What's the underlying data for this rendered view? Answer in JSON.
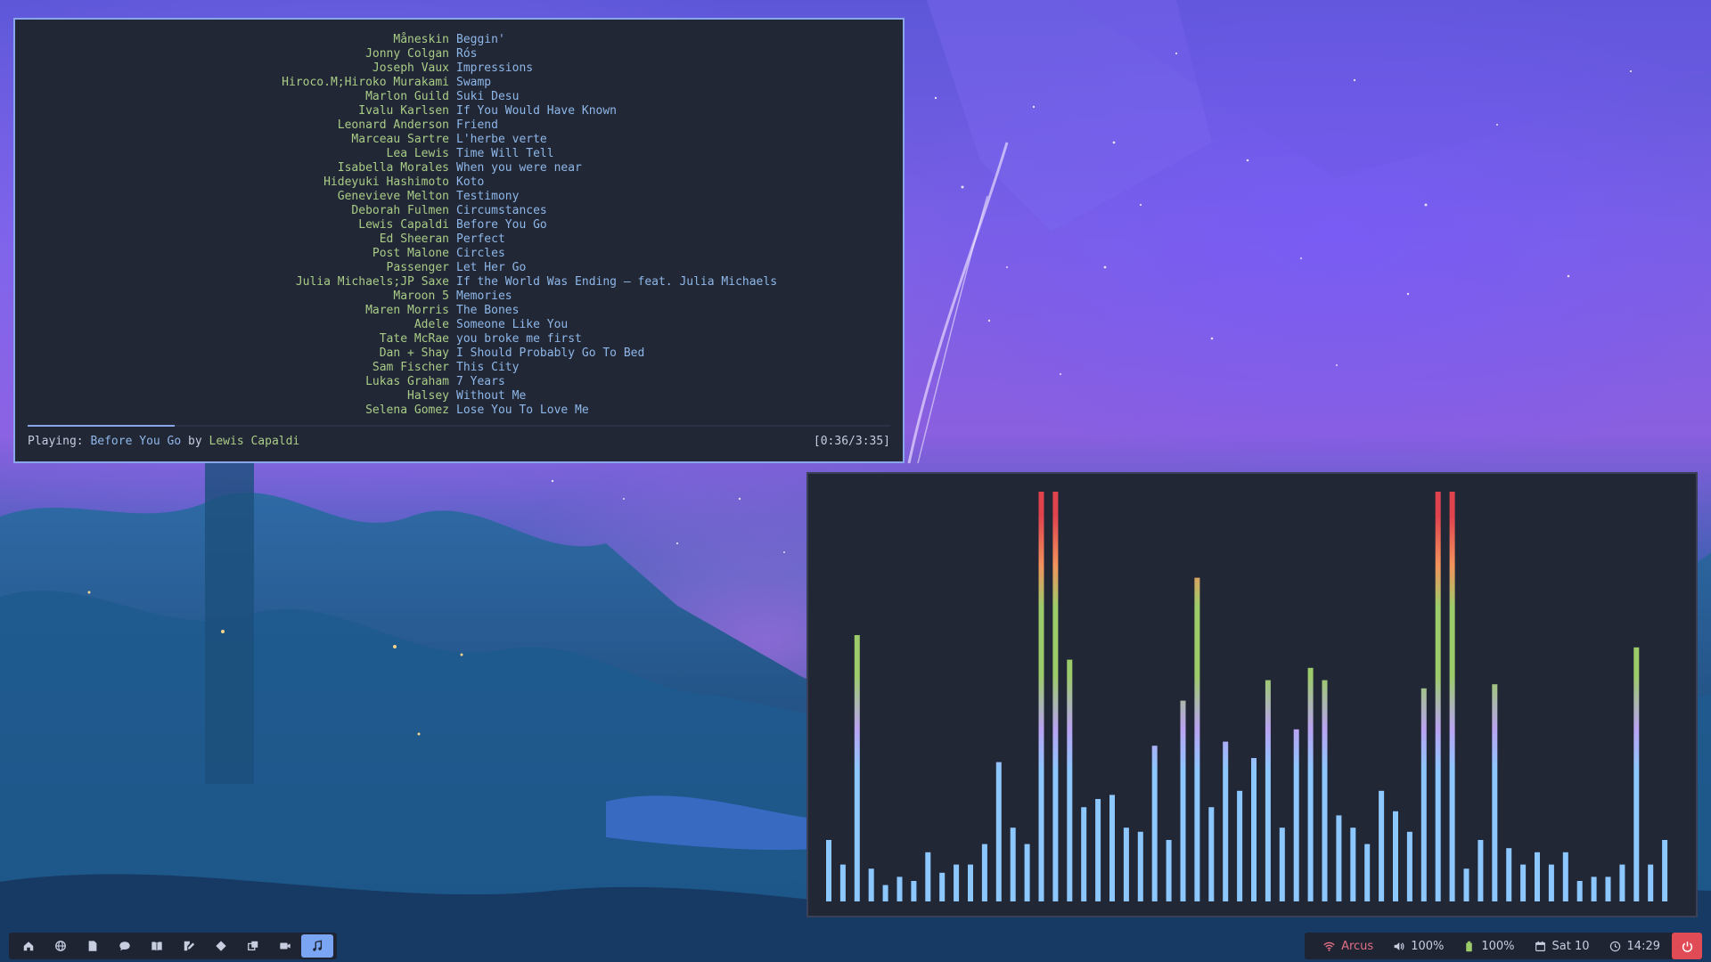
{
  "tracks": [
    {
      "artist": "Måneskin",
      "title": "Beggin'"
    },
    {
      "artist": "Jonny Colgan",
      "title": "Rós"
    },
    {
      "artist": "Joseph Vaux",
      "title": "Impressions"
    },
    {
      "artist": "Hiroco.M;Hiroko Murakami",
      "title": "Swamp"
    },
    {
      "artist": "Marlon Guild",
      "title": "Suki Desu"
    },
    {
      "artist": "Ivalu Karlsen",
      "title": "If You Would Have Known"
    },
    {
      "artist": "Leonard Anderson",
      "title": "Friend"
    },
    {
      "artist": "Marceau Sartre",
      "title": "L'herbe verte"
    },
    {
      "artist": "Lea Lewis",
      "title": "Time Will Tell"
    },
    {
      "artist": "Isabella Morales",
      "title": "When you were near"
    },
    {
      "artist": "Hideyuki Hashimoto",
      "title": "Koto"
    },
    {
      "artist": "Genevieve Melton",
      "title": "Testimony"
    },
    {
      "artist": "Deborah Fulmen",
      "title": "Circumstances"
    },
    {
      "artist": "Lewis Capaldi",
      "title": "Before You Go"
    },
    {
      "artist": "Ed Sheeran",
      "title": "Perfect"
    },
    {
      "artist": "Post Malone",
      "title": "Circles"
    },
    {
      "artist": "Passenger",
      "title": "Let Her Go"
    },
    {
      "artist": "Julia Michaels;JP Saxe",
      "title": "If the World Was Ending – feat. Julia Michaels"
    },
    {
      "artist": "Maroon 5",
      "title": "Memories"
    },
    {
      "artist": "Maren Morris",
      "title": "The Bones"
    },
    {
      "artist": "Adele",
      "title": "Someone Like You"
    },
    {
      "artist": "Tate McRae",
      "title": "you broke me first"
    },
    {
      "artist": "Dan + Shay",
      "title": "I Should Probably Go To Bed"
    },
    {
      "artist": "Sam Fischer",
      "title": "This City"
    },
    {
      "artist": "Lukas Graham",
      "title": "7 Years"
    },
    {
      "artist": "Halsey",
      "title": "Without Me"
    },
    {
      "artist": "Selena Gomez",
      "title": "Lose You To Love Me"
    }
  ],
  "status": {
    "label": "Playing:",
    "song": "Before You Go",
    "by": "by",
    "artist": "Lewis Capaldi",
    "time": "[0:36/3:35]",
    "progress": 0.17
  },
  "visualizer": {
    "levels": [
      0.15,
      0.09,
      0.65,
      0.08,
      0.04,
      0.06,
      0.05,
      0.12,
      0.07,
      0.09,
      0.09,
      0.14,
      0.34,
      0.18,
      0.14,
      1.0,
      1.0,
      0.59,
      0.23,
      0.25,
      0.26,
      0.18,
      0.17,
      0.38,
      0.15,
      0.49,
      0.79,
      0.23,
      0.39,
      0.27,
      0.35,
      0.54,
      0.18,
      0.42,
      0.57,
      0.54,
      0.21,
      0.18,
      0.14,
      0.27,
      0.22,
      0.17,
      0.52,
      1.0,
      1.0,
      0.08,
      0.15,
      0.53,
      0.13,
      0.09,
      0.12,
      0.09,
      0.12,
      0.05,
      0.06,
      0.06,
      0.09,
      0.62,
      0.09,
      0.15
    ],
    "colors": {
      "low": "#8cc7ff",
      "mid": "#b9a3f2",
      "high": "#9ccb6a",
      "top": "#f2935c",
      "peak": "#e0434e"
    }
  },
  "workspaces": [
    {
      "icon": "home-icon",
      "active": false
    },
    {
      "icon": "globe-icon",
      "active": false
    },
    {
      "icon": "file-icon",
      "active": false
    },
    {
      "icon": "chat-icon",
      "active": false
    },
    {
      "icon": "book-icon",
      "active": false
    },
    {
      "icon": "edit-icon",
      "active": false
    },
    {
      "icon": "git-icon",
      "active": false
    },
    {
      "icon": "windows-icon",
      "active": false
    },
    {
      "icon": "video-icon",
      "active": false
    },
    {
      "icon": "music-icon",
      "active": true
    }
  ],
  "statusbar": {
    "wifi": "Arcus",
    "volume": "100%",
    "battery": "100%",
    "date": "Sat 10",
    "time": "14:29",
    "accent": "#7aa5f2",
    "power_color": "#e04b55"
  }
}
